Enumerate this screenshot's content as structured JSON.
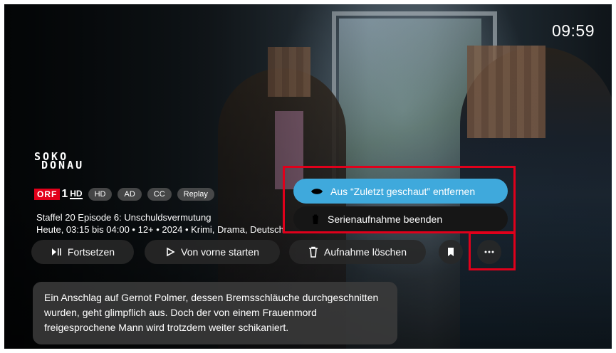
{
  "clock": "09:59",
  "show": {
    "logo_line1": "SOKO",
    "logo_line2": "DONAU"
  },
  "channel": {
    "name": "ORF",
    "number": "1",
    "quality": "HD"
  },
  "badges": [
    "HD",
    "AD",
    "CC",
    "Replay"
  ],
  "episode": {
    "title": "Staffel 20 Episode 6: Unschuldsvermutung",
    "meta": "Heute, 03:15 bis 04:00 • 12+ • 2024 • Krimi, Drama, Deutsch"
  },
  "actions": {
    "resume": "Fortsetzen",
    "restart": "Von vorne starten",
    "delete": "Aufnahme löschen"
  },
  "menu": {
    "remove_recent": "Aus “Zuletzt geschaut” entfernen",
    "end_series": "Serienaufnahme beenden"
  },
  "description": "Ein Anschlag auf Gernot Polmer, dessen Bremsschläuche durchgeschnitten wurden, geht glimpflich aus. Doch der von einem Frauenmord freigesprochene Mann wird trotzdem weiter schikaniert.",
  "icons": [
    "play-pause-icon",
    "play-icon",
    "trash-icon",
    "bookmark-icon",
    "more-icon",
    "eye-off-icon"
  ],
  "colors": {
    "highlight": "#e0001b",
    "primary_button": "#3fa9dc",
    "orf_red": "#e2001a"
  }
}
